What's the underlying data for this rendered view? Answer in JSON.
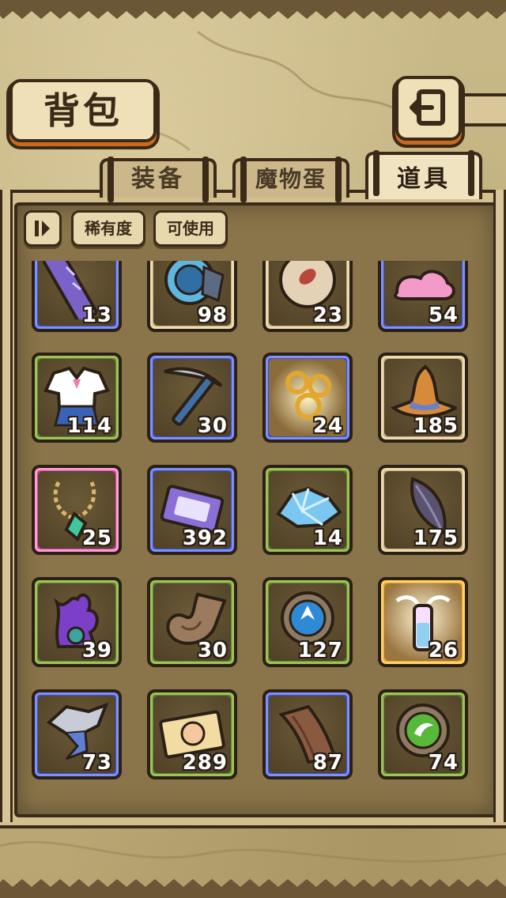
{
  "header": {
    "title": "背包",
    "back_icon": "return-arrow-icon"
  },
  "tabs": [
    {
      "label": "装备",
      "active": false
    },
    {
      "label": "魔物蛋",
      "active": false
    },
    {
      "label": "道具",
      "active": true
    }
  ],
  "filters": {
    "sort_icon": "sort-toggle-icon",
    "rarity_label": "稀有度",
    "usable_label": "可使用"
  },
  "items": [
    {
      "icon": "purple-scroll-icon",
      "count": "13",
      "rarity": "blue"
    },
    {
      "icon": "blue-shell-icon",
      "count": "98",
      "rarity": "tan"
    },
    {
      "icon": "seed-egg-icon",
      "count": "23",
      "rarity": "tan"
    },
    {
      "icon": "pink-slime-icon",
      "count": "54",
      "rarity": "blue"
    },
    {
      "icon": "sailor-uniform-icon",
      "count": "114",
      "rarity": "green"
    },
    {
      "icon": "pickaxe-icon",
      "count": "30",
      "rarity": "blue"
    },
    {
      "icon": "golden-rings-icon",
      "count": "24",
      "rarity": "blue"
    },
    {
      "icon": "witch-hat-icon",
      "count": "185",
      "rarity": "tan"
    },
    {
      "icon": "flower-necklace-icon",
      "count": "25",
      "rarity": "pink"
    },
    {
      "icon": "purple-ticket-icon",
      "count": "392",
      "rarity": "blue"
    },
    {
      "icon": "ice-crystal-icon",
      "count": "14",
      "rarity": "green"
    },
    {
      "icon": "dark-feather-icon",
      "count": "175",
      "rarity": "tan"
    },
    {
      "icon": "purple-tentacle-monster-icon",
      "count": "39",
      "rarity": "green"
    },
    {
      "icon": "horn-icon",
      "count": "30",
      "rarity": "green"
    },
    {
      "icon": "blue-rune-stone-icon",
      "count": "127",
      "rarity": "green"
    },
    {
      "icon": "winged-potion-icon",
      "count": "26",
      "rarity": "orange"
    },
    {
      "icon": "steel-fish-icon",
      "count": "73",
      "rarity": "blue"
    },
    {
      "icon": "cat-ticket-icon",
      "count": "289",
      "rarity": "green"
    },
    {
      "icon": "wooden-plank-icon",
      "count": "87",
      "rarity": "blue"
    },
    {
      "icon": "green-rune-stone-icon",
      "count": "74",
      "rarity": "green"
    }
  ],
  "colors": {
    "rarity_green": "#5f8a2e",
    "rarity_blue": "#3f52b8",
    "rarity_tan": "#c9b185",
    "rarity_pink": "#d0489e",
    "rarity_orange": "#f0a31e",
    "outline": "#3b2a18"
  }
}
